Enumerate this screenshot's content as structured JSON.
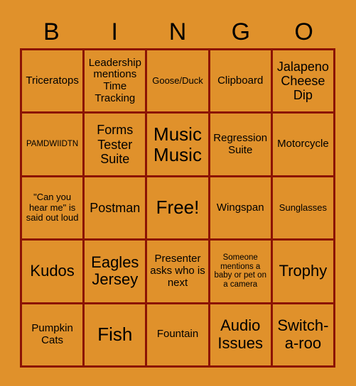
{
  "card": {
    "title_letters": [
      "B",
      "I",
      "N",
      "G",
      "O"
    ],
    "colors": {
      "background": "#e0912b",
      "border": "#8b1305",
      "text": "#000000"
    },
    "rows": [
      [
        {
          "text": "Triceratops",
          "size": "m"
        },
        {
          "text": "Leadership mentions Time Tracking",
          "size": "m"
        },
        {
          "text": "Goose/Duck",
          "size": "s"
        },
        {
          "text": "Clipboard",
          "size": "m"
        },
        {
          "text": "Jalapeno Cheese Dip",
          "size": "l"
        }
      ],
      [
        {
          "text": "PAMDWIIDTN",
          "size": "xs"
        },
        {
          "text": "Forms Tester Suite",
          "size": "l"
        },
        {
          "text": "Music Music",
          "size": "xxl"
        },
        {
          "text": "Regression Suite",
          "size": "m"
        },
        {
          "text": "Motorcycle",
          "size": "m"
        }
      ],
      [
        {
          "text": "\"Can you hear me\" is said out loud",
          "size": "s"
        },
        {
          "text": "Postman",
          "size": "l"
        },
        {
          "text": "Free!",
          "size": "xxl"
        },
        {
          "text": "Wingspan",
          "size": "m"
        },
        {
          "text": "Sunglasses",
          "size": "s"
        }
      ],
      [
        {
          "text": "Kudos",
          "size": "xl"
        },
        {
          "text": "Eagles Jersey",
          "size": "xl"
        },
        {
          "text": "Presenter asks who is next",
          "size": "m"
        },
        {
          "text": "Someone mentions a baby or pet on a camera",
          "size": "xs"
        },
        {
          "text": "Trophy",
          "size": "xl"
        }
      ],
      [
        {
          "text": "Pumpkin Cats",
          "size": "m"
        },
        {
          "text": "Fish",
          "size": "xxl"
        },
        {
          "text": "Fountain",
          "size": "m"
        },
        {
          "text": "Audio Issues",
          "size": "xl"
        },
        {
          "text": "Switch-a-roo",
          "size": "xl"
        }
      ]
    ]
  }
}
